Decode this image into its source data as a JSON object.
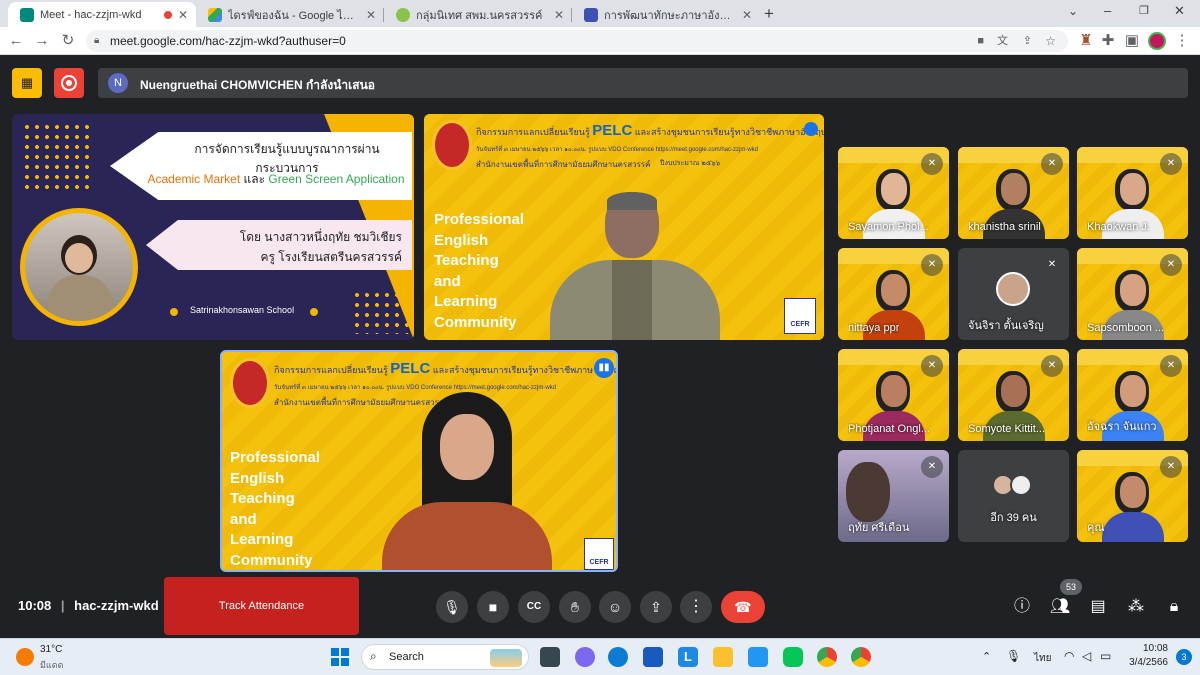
{
  "browser": {
    "tabs": [
      {
        "title": "Meet - hac-zzjm-wkd",
        "active": true
      },
      {
        "title": "ไดรฟ์ของฉัน - Google ไดรฟ์",
        "active": false
      },
      {
        "title": "กลุ่มนิเทศ สพม.นครสวรรค์",
        "active": false
      },
      {
        "title": "การพัฒนาทักษะภาษาอังกฤษ English",
        "active": false
      }
    ],
    "url": "meet.google.com/hac-zzjm-wkd?authuser=0"
  },
  "meet": {
    "presenter_avatar": "N",
    "presenter_banner": "Nuengruethai CHOMVICHEN กำลังนำเสนอ",
    "slide": {
      "title": "การจัดการเรียนรู้แบบบูรณาการผ่านกระบวนการ",
      "sub_a": "Academic Market",
      "sub_and": "และ",
      "sub_b": "Green Screen Application",
      "by_line1": "โดย นางสาวหนึ่งฤทัย ชมวิเชียร",
      "by_line2": "ครู โรงเรียนสตรีนครสวรรค์",
      "school": "Satrinakhonsawan School"
    },
    "banner": {
      "line1": "กิจกรรมการแลกเปลี่ยนเรียนรู้",
      "pelc": "PELC",
      "line1b": "และสร้างชุมชนการเรียนรู้ทางวิชาชีพภาษาอังกฤษ",
      "line2": "วันจันทร์ที่ ๓ เมษายน ๒๕๖๖ เวลา ๑๐.๐๐น. รูปแบบ VDO Conference https://meet.google.com/hac-zzjm-wkd",
      "line3": "สำนักงานเขตพื้นที่การศึกษามัธยมศึกษานครสวรรค์",
      "year": "ปีงบประมาณ ๒๕๖๖",
      "pet_lines": [
        "Professional",
        "English",
        "Teaching",
        "and",
        "Learning",
        "Community"
      ],
      "cefr": "CEFR"
    },
    "participants": [
      {
        "name": "Sayamon Phol..."
      },
      {
        "name": "khanistha srinil"
      },
      {
        "name": "Khaokwan J."
      },
      {
        "name": "nittaya ppr"
      },
      {
        "name": "จันจิรา ตั้นเจริญ"
      },
      {
        "name": "Sapsomboon ..."
      },
      {
        "name": "Photjanat Ongl..."
      },
      {
        "name": "Somyote Kittit..."
      },
      {
        "name": "อัจฉรา จันแกว"
      },
      {
        "name": "ฤทัย ศรีเดือน"
      },
      {
        "name": "อีก 39 คน"
      },
      {
        "name": "คุณ"
      }
    ],
    "time": "10:08",
    "meeting_code": "hac-zzjm-wkd",
    "track_attendance": "Track Attendance",
    "people_count": "53"
  },
  "taskbar": {
    "temp": "31°C",
    "weather": "มีแดด",
    "search": "Search",
    "lang": "ไทย",
    "clock_time": "10:08",
    "clock_date": "3/4/2566",
    "notif_count": "3"
  },
  "colors": {
    "accent_red": "#ea4335",
    "meet_bg": "#202124",
    "slide_yellow": "#f4c20d",
    "slide_navy": "#2a2557"
  }
}
